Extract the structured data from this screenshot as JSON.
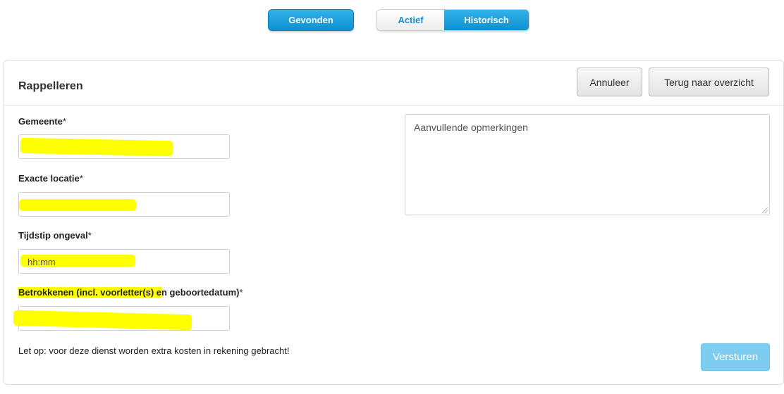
{
  "topnav": {
    "found_label": "Gevonden",
    "active_label": "Actief",
    "history_label": "Historisch"
  },
  "panel": {
    "title": "Rappelleren",
    "cancel_label": "Annuleer",
    "back_label": "Terug naar overzicht"
  },
  "form": {
    "gemeente_label": "Gemeente",
    "locatie_label": "Exacte locatie",
    "tijdstip_label": "Tijdstip ongeval",
    "tijdstip_placeholder": "hh:mm",
    "betrokkenen_label_a": "Betrokkenen (incl. voorletter(s) e",
    "betrokkenen_label_b": "n geboortedatum)",
    "required_mark": "*",
    "remarks_placeholder": "Aanvullende opmerkingen",
    "note": "Let op: voor deze dienst worden extra kosten in rekening gebracht!",
    "submit_label": "Versturen"
  },
  "colors": {
    "accent_blue": "#0e8fd0",
    "highlight_yellow": "#ffff00",
    "submit_disabled": "#7ecdf1"
  }
}
